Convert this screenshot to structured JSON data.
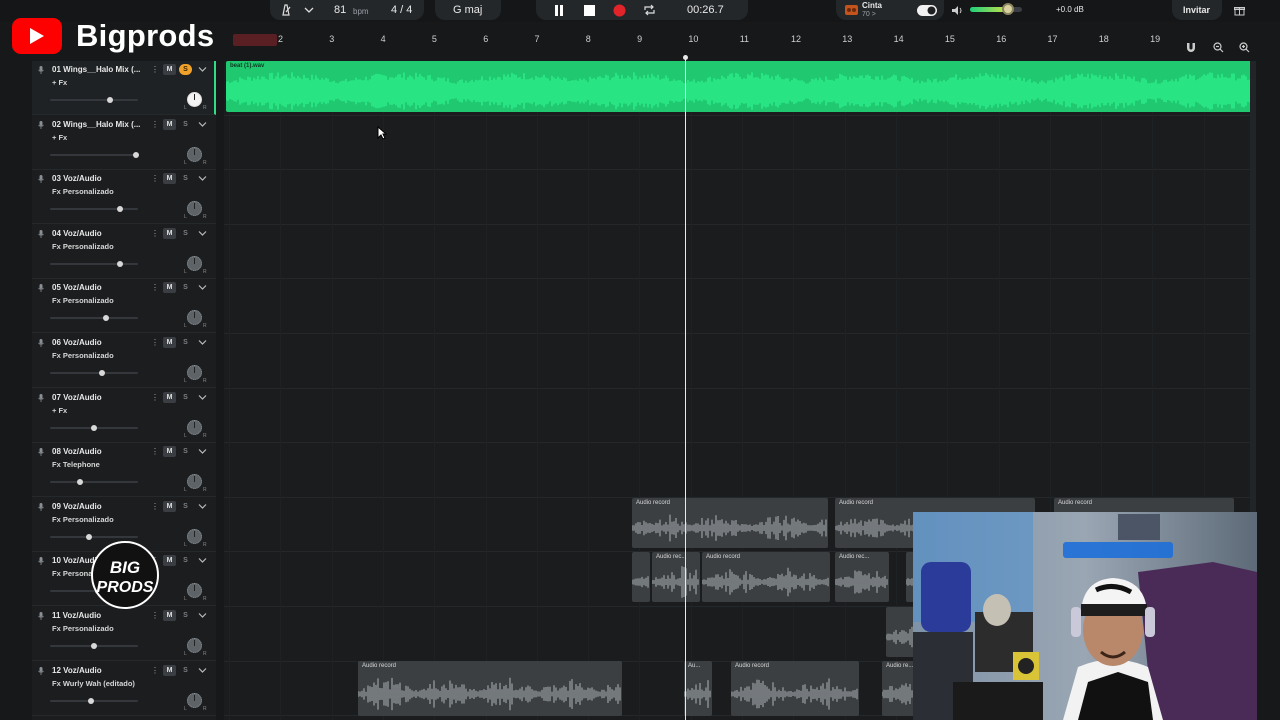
{
  "overlay": {
    "channel_name": "Bigprods",
    "watermark_line1": "BIG",
    "watermark_line2": "PRODS"
  },
  "transport": {
    "bpm_value": "81",
    "bpm_unit": "bpm",
    "time_signature": "4 / 4",
    "key": "G maj",
    "time": "00:26.7"
  },
  "header": {
    "tape_label": "Cinta",
    "tape_sub": "70 >",
    "master_db": "+0.0 dB",
    "invite_label": "Invitar",
    "master_volume": 0.74
  },
  "ruler": {
    "bars": [
      "2",
      "3",
      "4",
      "5",
      "6",
      "7",
      "8",
      "9",
      "10",
      "11",
      "12",
      "13",
      "14",
      "15",
      "16",
      "17",
      "18",
      "19"
    ]
  },
  "tracks": [
    {
      "name": "01 Wings__Halo Mix (...",
      "fx": "+ Fx",
      "mute": "M",
      "solo": "S",
      "solo_on": true,
      "volume": 0.68,
      "selected": true
    },
    {
      "name": "02 Wings__Halo Mix (...",
      "fx": "+ Fx",
      "mute": "M",
      "solo": "S",
      "solo_on": false,
      "volume": 0.98
    },
    {
      "name": "03 Voz/Audio",
      "fx": "Fx Personalizado",
      "mute": "M",
      "solo": "S",
      "solo_on": false,
      "volume": 0.8
    },
    {
      "name": "04 Voz/Audio",
      "fx": "Fx Personalizado",
      "mute": "M",
      "solo": "S",
      "solo_on": false,
      "volume": 0.8
    },
    {
      "name": "05 Voz/Audio",
      "fx": "Fx Personalizado",
      "mute": "M",
      "solo": "S",
      "solo_on": false,
      "volume": 0.64
    },
    {
      "name": "06 Voz/Audio",
      "fx": "Fx Personalizado",
      "mute": "M",
      "solo": "S",
      "solo_on": false,
      "volume": 0.59
    },
    {
      "name": "07 Voz/Audio",
      "fx": "+ Fx",
      "mute": "M",
      "solo": "S",
      "solo_on": false,
      "volume": 0.5
    },
    {
      "name": "08 Voz/Audio",
      "fx": "Fx Telephone",
      "mute": "M",
      "solo": "S",
      "solo_on": false,
      "volume": 0.34
    },
    {
      "name": "09 Voz/Audio",
      "fx": "Fx Personalizado",
      "mute": "M",
      "solo": "S",
      "solo_on": false,
      "volume": 0.44
    },
    {
      "name": "10 Voz/Audio",
      "fx": "Fx Personalizado",
      "mute": "M",
      "solo": "S",
      "solo_on": false,
      "volume": 0.55
    },
    {
      "name": "11 Voz/Audio",
      "fx": "Fx Personalizado",
      "mute": "M",
      "solo": "S",
      "solo_on": false,
      "volume": 0.5
    },
    {
      "name": "12 Voz/Audio",
      "fx": "Fx Wurly Wah (editado)",
      "mute": "M",
      "solo": "S",
      "solo_on": false,
      "volume": 0.47
    }
  ],
  "clips": {
    "beat": "beat (1).wav",
    "t09_a": "Audio record",
    "t09_b": "Audio record",
    "t09_c": "Audio record",
    "t10_a": "Audio rec...",
    "t10_b": "Audio record",
    "t10_c": "Audio rec...",
    "t12_a": "Audio record",
    "t12_b": "Au...",
    "t12_c": "Audio record",
    "t12_d": "Audio re..."
  },
  "colors": {
    "accent": "#2fe083",
    "clip_green": "#20c870",
    "record": "#e0242a",
    "solo": "#f0a22a",
    "youtube": "#ff0000"
  },
  "icons": [
    "metronome-icon",
    "chevron-down-icon",
    "pause-icon",
    "stop-icon",
    "record-icon",
    "loop-icon",
    "tape-icon",
    "toggle-icon",
    "speaker-icon",
    "gift-icon",
    "magnet-icon",
    "zoom-out-icon",
    "zoom-in-icon",
    "mic-icon",
    "more-icon"
  ]
}
